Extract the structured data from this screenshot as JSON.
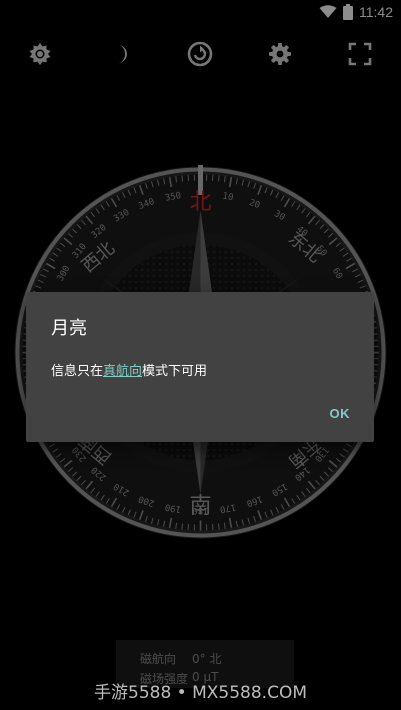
{
  "status_bar": {
    "time": "11:42",
    "icons": [
      "wifi-icon",
      "battery-icon"
    ]
  },
  "toolbar": {
    "buttons": [
      {
        "name": "sun-icon"
      },
      {
        "name": "moon-icon"
      },
      {
        "name": "rotate-icon"
      },
      {
        "name": "settings-icon"
      },
      {
        "name": "fullscreen-icon"
      }
    ]
  },
  "compass": {
    "cardinals": {
      "north": "北",
      "south": "南"
    },
    "intercardinals": {
      "northwest": "西北",
      "northeast": "东北",
      "southwest": "西南",
      "southeast": "东南"
    },
    "degree_labels": [
      "350",
      "10",
      "20",
      "30",
      "40",
      "50",
      "60",
      "340",
      "330",
      "320",
      "310",
      "300",
      "130",
      "140",
      "150",
      "160",
      "170",
      "180",
      "190",
      "200",
      "210",
      "220",
      "230"
    ],
    "accent_color": "#c62828"
  },
  "dialog": {
    "title": "月亮",
    "message_prefix": "信息只在",
    "message_link": "真航向",
    "message_suffix": "模式下可用",
    "ok_label": "OK",
    "link_color": "#80cbc4"
  },
  "readout": {
    "heading_label": "磁航向",
    "heading_value": "0° 北",
    "field_label": "磁场强度",
    "field_value": "0 μT"
  },
  "watermark": "手游5588 • MX5588.COM"
}
